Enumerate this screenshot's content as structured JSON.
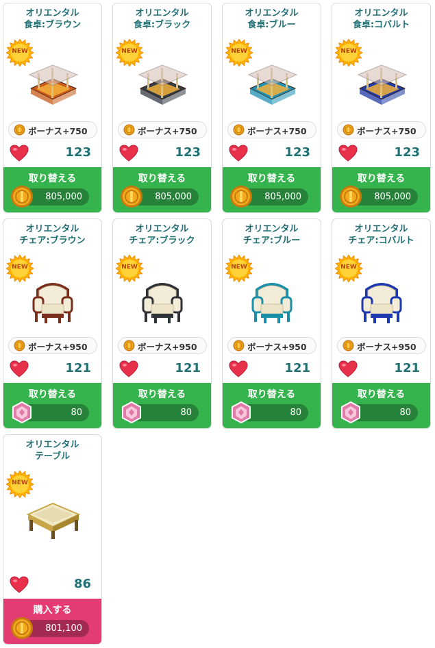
{
  "products": [
    {
      "name_line1": "オリエンタル",
      "name_line2": "食卓:ブラウン",
      "badge": "NEW",
      "bonus": "ボーナス+750",
      "likes": "123",
      "action": "取り替える",
      "price": "805,000",
      "currency": "coin",
      "kind": "table",
      "color": "#c85a19"
    },
    {
      "name_line1": "オリエンタル",
      "name_line2": "食卓:ブラック",
      "badge": "NEW",
      "bonus": "ボーナス+750",
      "likes": "123",
      "action": "取り替える",
      "price": "805,000",
      "currency": "coin",
      "kind": "table",
      "color": "#333a44"
    },
    {
      "name_line1": "オリエンタル",
      "name_line2": "食卓:ブルー",
      "badge": "NEW",
      "bonus": "ボーナス+750",
      "likes": "123",
      "action": "取り替える",
      "price": "805,000",
      "currency": "coin",
      "kind": "table",
      "color": "#1f8fb3"
    },
    {
      "name_line1": "オリエンタル",
      "name_line2": "食卓:コバルト",
      "badge": "NEW",
      "bonus": "ボーナス+750",
      "likes": "123",
      "action": "取り替える",
      "price": "805,000",
      "currency": "coin",
      "kind": "table",
      "color": "#1f3aa3"
    },
    {
      "name_line1": "オリエンタル",
      "name_line2": "チェア:ブラウン",
      "badge": "NEW",
      "bonus": "ボーナス+950",
      "likes": "121",
      "action": "取り替える",
      "price": "80",
      "currency": "gem",
      "kind": "chair",
      "color": "#7a2f1c"
    },
    {
      "name_line1": "オリエンタル",
      "name_line2": "チェア:ブラック",
      "badge": "NEW",
      "bonus": "ボーナス+950",
      "likes": "121",
      "action": "取り替える",
      "price": "80",
      "currency": "gem",
      "kind": "chair",
      "color": "#2f3338"
    },
    {
      "name_line1": "オリエンタル",
      "name_line2": "チェア:ブルー",
      "badge": "NEW",
      "bonus": "ボーナス+950",
      "likes": "121",
      "action": "取り替える",
      "price": "80",
      "currency": "gem",
      "kind": "chair",
      "color": "#1c8fa8"
    },
    {
      "name_line1": "オリエンタル",
      "name_line2": "チェア:コバルト",
      "badge": "NEW",
      "bonus": "ボーナス+950",
      "likes": "121",
      "action": "取り替える",
      "price": "80",
      "currency": "gem",
      "kind": "chair",
      "color": "#1e39b0"
    },
    {
      "name_line1": "オリエンタル",
      "name_line2": "テーブル",
      "badge": "NEW",
      "bonus": "",
      "likes": "86",
      "action": "購入する",
      "price": "801,100",
      "currency": "coin",
      "kind": "lowtable",
      "color": "#c9a64a"
    }
  ]
}
